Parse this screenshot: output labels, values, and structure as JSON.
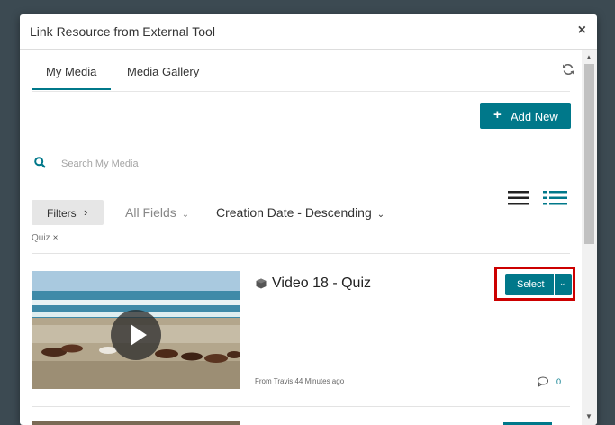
{
  "dialog": {
    "title": "Link Resource from External Tool",
    "close_label": "×"
  },
  "tabs": [
    {
      "label": "My Media",
      "active": true
    },
    {
      "label": "Media Gallery",
      "active": false
    }
  ],
  "toolbar": {
    "add_new_label": "Add New"
  },
  "search": {
    "placeholder": "Search My Media"
  },
  "filters": {
    "filters_label": "Filters",
    "fields_label": "All Fields",
    "sort_label": "Creation Date - Descending",
    "tags": [
      {
        "label": "Quiz"
      }
    ]
  },
  "entries": [
    {
      "title": "Video 18 - Quiz",
      "meta": "From Travis 44 Minutes ago",
      "comments": "0",
      "select_label": "Select"
    }
  ],
  "colors": {
    "accent": "#00788a",
    "highlight": "#cc0000"
  }
}
